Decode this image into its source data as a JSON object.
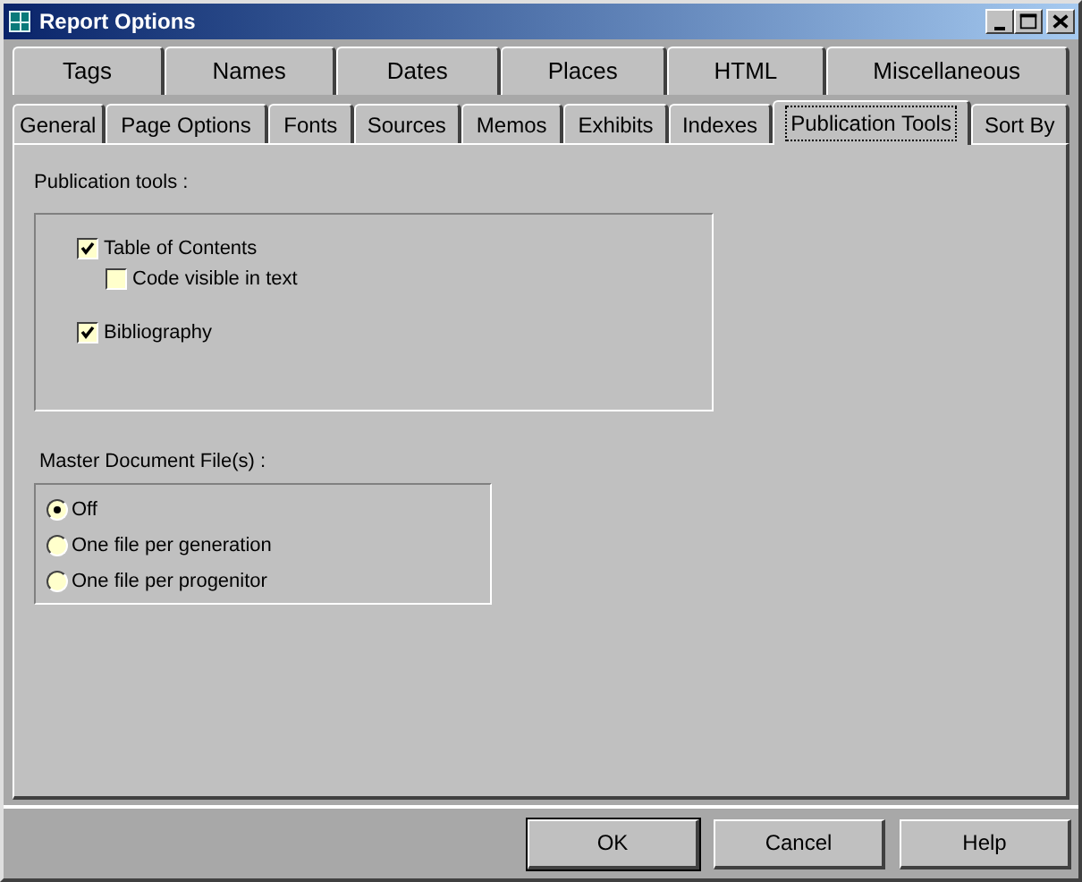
{
  "window": {
    "title": "Report Options"
  },
  "tab_rows": [
    [
      {
        "label": "Tags",
        "selected": false
      },
      {
        "label": "Names",
        "selected": false
      },
      {
        "label": "Dates",
        "selected": false
      },
      {
        "label": "Places",
        "selected": false
      },
      {
        "label": "HTML",
        "selected": false
      },
      {
        "label": "Miscellaneous",
        "selected": false
      }
    ],
    [
      {
        "label": "General",
        "selected": false
      },
      {
        "label": "Page Options",
        "selected": false
      },
      {
        "label": "Fonts",
        "selected": false
      },
      {
        "label": "Sources",
        "selected": false
      },
      {
        "label": "Memos",
        "selected": false
      },
      {
        "label": "Exhibits",
        "selected": false
      },
      {
        "label": "Indexes",
        "selected": false
      },
      {
        "label": "Publication Tools",
        "selected": true
      },
      {
        "label": "Sort By",
        "selected": false
      }
    ]
  ],
  "publication_tools": {
    "label": "Publication tools :",
    "options": [
      {
        "label": "Table of Contents",
        "checked": true,
        "children": [
          {
            "label": "Code visible in text",
            "checked": false
          }
        ]
      },
      {
        "label": "Bibliography",
        "checked": true
      }
    ]
  },
  "master_document": {
    "label": "Master Document File(s) :",
    "options": [
      {
        "label": "Off",
        "selected": true
      },
      {
        "label": "One file per generation",
        "selected": false
      },
      {
        "label": "One file per progenitor",
        "selected": false
      }
    ]
  },
  "buttons": [
    "OK",
    "Cancel",
    "Help"
  ]
}
